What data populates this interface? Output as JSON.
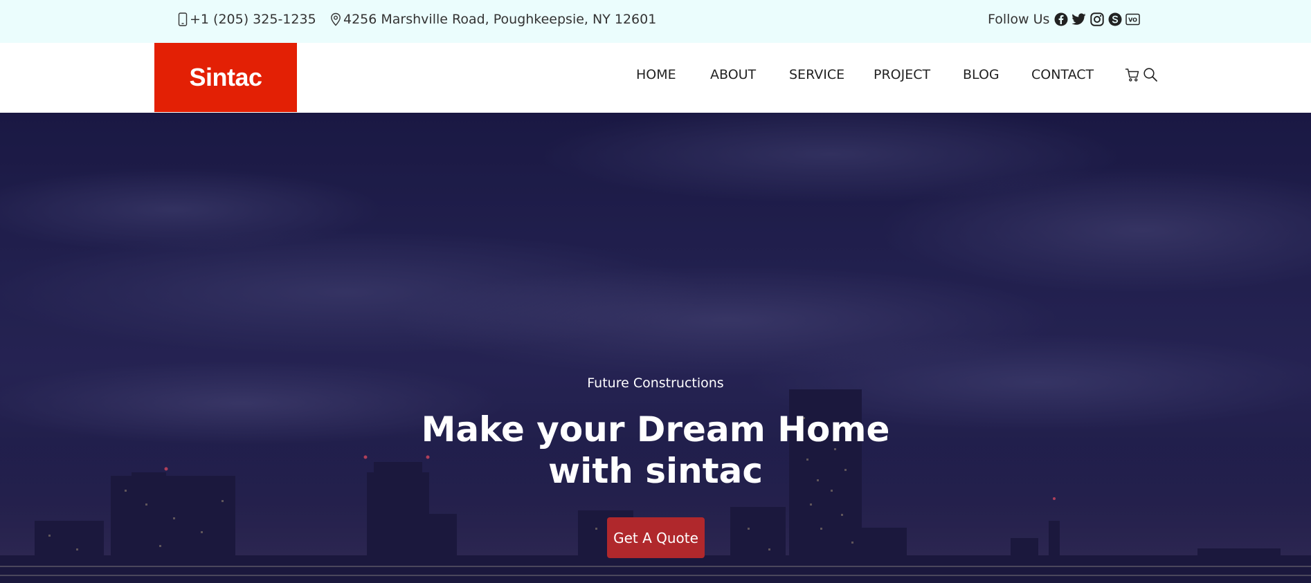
{
  "topbar": {
    "phone": "+1 (205) 325-1235",
    "address": "4256 Marshville Road, Poughkeepsie, NY 12601",
    "follow_label": "Follow Us",
    "social_icons": [
      "facebook-icon",
      "twitter-icon",
      "instagram-icon",
      "skype-icon",
      "vimeo-icon"
    ]
  },
  "navbar": {
    "logo": "Sintac",
    "links": [
      "HOME",
      "ABOUT",
      "SERVICE",
      "PROJECT",
      "BLOG",
      "CONTACT"
    ],
    "icons": [
      "cart-icon",
      "search-icon"
    ]
  },
  "hero": {
    "subtitle": "Future Constructions",
    "title_line1": "Make your Dream Home",
    "title_line2": "with sintac",
    "cta_label": "Get A Quote"
  },
  "colors": {
    "topbar_bg": "#ebfdfd",
    "logo_bg": "#e32005",
    "cta_bg": "#b0282c",
    "hero_bg": "#252452"
  }
}
